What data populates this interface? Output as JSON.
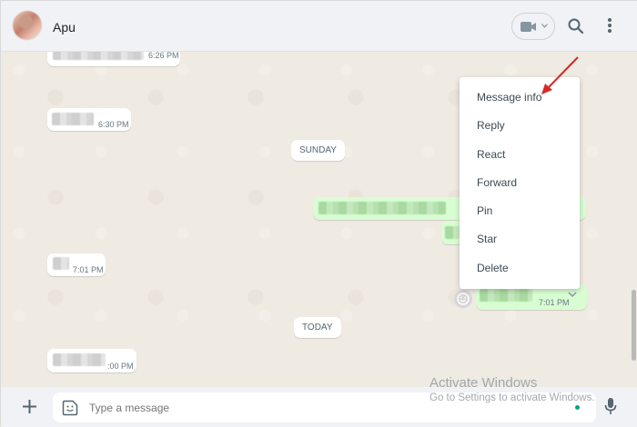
{
  "header": {
    "contact_name": "Apu"
  },
  "chat": {
    "messages": [
      {
        "direction": "in",
        "time": "6:26 PM"
      },
      {
        "direction": "in",
        "time": "6:30 PM"
      },
      {
        "direction": "out",
        "time": ""
      },
      {
        "direction": "in",
        "time": "7:01 PM"
      },
      {
        "direction": "out",
        "time": "7:01 PM"
      },
      {
        "direction": "in",
        "time": ":00 PM"
      }
    ],
    "date_separators": [
      "SUNDAY",
      "TODAY"
    ]
  },
  "context_menu": {
    "items": [
      "Message info",
      "Reply",
      "React",
      "Forward",
      "Pin",
      "Star",
      "Delete"
    ]
  },
  "composer": {
    "placeholder": "Type a message"
  },
  "watermark": {
    "title": "Activate Windows",
    "subtitle": "Go to Settings to activate Windows."
  },
  "colors": {
    "incoming_bubble": "#ffffff",
    "outgoing_bubble": "#d9fdd3",
    "annotation_arrow": "#d42a2a",
    "accent": "#00a884"
  },
  "icons": {
    "video": "video-camera-icon",
    "search": "search-icon",
    "menu": "kebab-menu-icon",
    "attach": "plus-icon",
    "sticker": "sticker-icon",
    "voice": "microphone-icon",
    "react": "emoji-icon"
  }
}
